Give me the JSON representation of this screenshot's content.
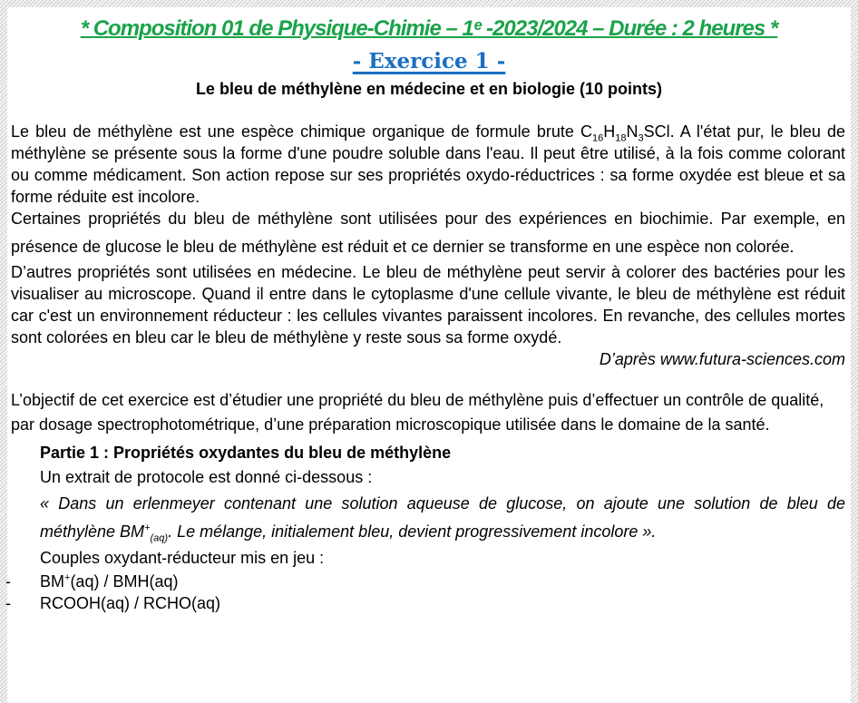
{
  "header": {
    "title": "* Composition 01 de Physique-Chimie – 1ᵉ -2023/2024 – Durée : 2 heures *",
    "exercise": "- Exercice 1 -",
    "subtitle": "Le bleu de méthylène en médecine et en biologie (10 points)"
  },
  "intro": {
    "p1a": "Le bleu de méthylène est une espèce chimique organique de formule brute C",
    "f1": "16",
    "f2": "H",
    "f3": "18",
    "f4": "N",
    "f5": "3",
    "p1b": "SCl. A l'état pur, le bleu de méthylène se présente sous la forme d'une poudre soluble dans l'eau. Il peut être utilisé, à la fois comme colorant ou comme médicament. Son action repose sur ses propriétés oxydo-réductrices : sa forme oxydée est bleue et sa forme réduite est incolore.",
    "p2": "Certaines propriétés du bleu de méthylène sont utilisées pour des expériences en biochimie. Par exemple, en présence de glucose le bleu de méthylène est réduit et ce dernier se transforme en une espèce non colorée.",
    "p3": "D’autres propriétés sont utilisées en médecine. Le bleu de méthylène peut servir à colorer des bactéries pour les visualiser au microscope. Quand il entre dans le cytoplasme d'une cellule vivante, le bleu de méthylène est réduit car c'est un environnement réducteur : les cellules vivantes paraissent incolores. En revanche, des cellules mortes sont colorées en bleu car le bleu de méthylène y reste sous sa forme oxydé.",
    "source": "D’après www.futura-sciences.com"
  },
  "objective": "L’objectif de cet exercice est d’étudier une propriété du bleu de méthylène puis d’effectuer un contrôle de qualité, par dosage spectrophotométrique, d’une préparation microscopique utilisée dans le domaine de la santé.",
  "part1": {
    "title": "Partie 1 : Propriétés oxydantes du bleu de méthylène",
    "intro": "Un extrait de protocole est donné ci-dessous :",
    "quote_a": "« Dans un erlenmeyer contenant une solution aqueuse de glucose, on ajoute une solution de bleu de méthylène BM",
    "quote_sup": "+",
    "quote_sub": "(aq)",
    "quote_b": ". Le mélange, initialement bleu, devient progressivement incolore ».",
    "couples_label": "Couples oxydant-réducteur mis en jeu :",
    "couples": [
      {
        "dash": "-",
        "a": "BM",
        "sup": "+",
        "b": "(aq) / BMH(aq)"
      },
      {
        "dash": "-",
        "a": "RCOOH(aq) / RCHO(aq)"
      }
    ]
  }
}
